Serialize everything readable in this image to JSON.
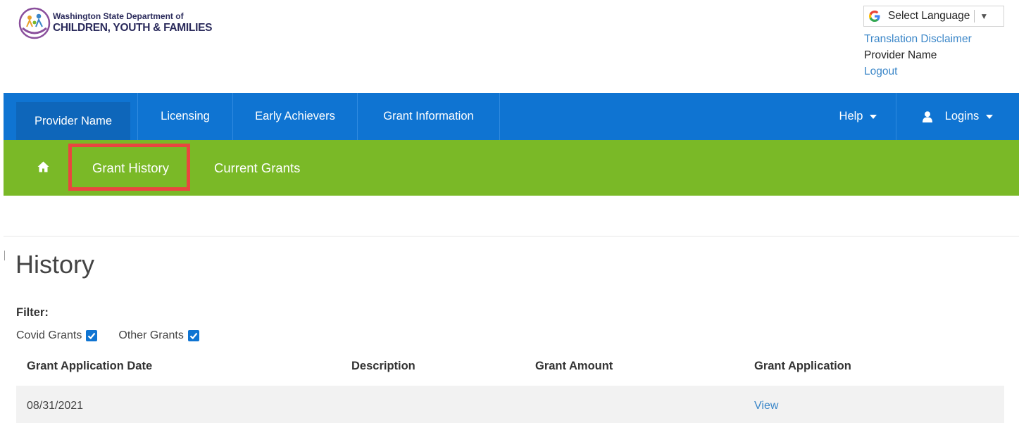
{
  "logo": {
    "line1": "Washington State Department of",
    "line2": "CHILDREN, YOUTH & FAMILIES"
  },
  "language": {
    "label": "Select Language",
    "arrow": "▼"
  },
  "top_links": {
    "disclaimer": "Translation Disclaimer",
    "provider": "Provider Name",
    "logout": "Logout"
  },
  "nav": {
    "provider": "Provider Name",
    "licensing": "Licensing",
    "early_achievers": "Early Achievers",
    "grant_information": "Grant Information",
    "help": "Help",
    "logins": "Logins"
  },
  "subnav": {
    "grant_history": "Grant History",
    "current_grants": "Current Grants"
  },
  "page": {
    "title": "History",
    "filter_label": "Filter:",
    "filters": [
      {
        "label": "Covid Grants",
        "checked": true
      },
      {
        "label": "Other Grants",
        "checked": true
      }
    ]
  },
  "table": {
    "columns": [
      "Grant Application Date",
      "Description",
      "Grant Amount",
      "Grant Application"
    ],
    "rows": [
      {
        "date": "08/31/2021",
        "description": "",
        "amount": "",
        "application": "View"
      }
    ]
  },
  "colors": {
    "nav_blue": "#0f74d2",
    "subnav_green": "#7ab927",
    "highlight_red": "#e8473f",
    "link_blue": "#3a86c8"
  }
}
